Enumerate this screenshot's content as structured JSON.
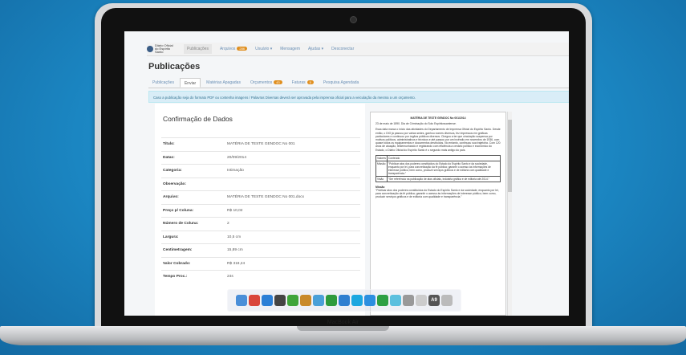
{
  "device": {
    "brand": "MacBook Air"
  },
  "app": {
    "logo_text": "Diário Oficial do Espírito Santo"
  },
  "nav": {
    "items": [
      {
        "label": "Publicações"
      },
      {
        "label": "Arquivos",
        "badge": "286"
      },
      {
        "label": "Usuário ▾"
      },
      {
        "label": "Mensagem"
      },
      {
        "label": "Ajudas ▾"
      },
      {
        "label": "Desconectar"
      }
    ]
  },
  "page": {
    "title": "Publicações"
  },
  "tabs": [
    {
      "label": "Publicações"
    },
    {
      "label": "Enviar"
    },
    {
      "label": "Matérias Apagadas"
    },
    {
      "label": "Orçamentos",
      "badge": "43"
    },
    {
      "label": "Faturas",
      "badge": "5"
    },
    {
      "label": "Pesquisa Agendada"
    }
  ],
  "alert": {
    "text": "Caso a publicação seja do formato PDF ou contenha imagens / Palavras Diversas deverá ser aprovada pela imprensa oficial para a veiculação da mesma a um orçamento."
  },
  "confirm": {
    "title": "Confirmação de Dados",
    "rows": [
      {
        "key": "Título:",
        "value": "MATÉRIA DE TESTE GENDOC No 001"
      },
      {
        "key": "Datas:",
        "value": "20/09/2014"
      },
      {
        "key": "Categoria:",
        "value": "Intimação"
      },
      {
        "key": "Observação:",
        "value": ""
      },
      {
        "key": "Arquivo:",
        "value": "MATÉRIA DE TESTE GENDOC No 001.docx"
      },
      {
        "key": "Preço p/ Coluna:",
        "value": "R$ 10,02"
      },
      {
        "key": "Número de Coluna:",
        "value": "2"
      },
      {
        "key": "Largura:",
        "value": "10,5 cm"
      },
      {
        "key": "Centimetragem:",
        "value": "15,89 cm"
      },
      {
        "key": "Valor Cobrado:",
        "value": "R$ 318,24"
      },
      {
        "key": "Tempo Proc.:",
        "value": "24s"
      }
    ]
  },
  "preview": {
    "title": "MATÉRIA DE TESTE GENDOC No 001/2014",
    "subtitle": "23 de maio de 1890. Dia de Criminação do Solo Espiritossantense.",
    "para1": "Essa data marca o início das atividades do Departamento de Imprensa Oficial do Espírito Santo. Desde então, o DIO já passou por várias sedes, ganhou nomes diversos, fez impressos em gráficas particulares e continuou por órgãos públicos diversos. Chegou a ter que circulação suspensa por motivos políticos, administrativos e técnicos e até passou por um incêndio em novembro de 1936, com quase todos os equipamentos e documentos destruídos. No entanto, continuou sua trajetória. Com 120 anos de atuação, testemunhando e registrando com eficiência a cenário político e econômico do Estado, o Diário Oficial do Espírito Santo é o segundo mais antigo do país.",
    "table": {
      "headers": [
        "Valores",
        "Conteúdo"
      ],
      "rows": [
        [
          "Missão",
          "\"Publicar atos dos poderes constituídos do Estado do Espírito Santo e da sociedade, enquanto por lei, para concretização da fé pública; garantir o acesso às informações de interesse público; bem como, produzir serviços gráficos e de editoria com qualidade e transparência.\""
        ],
        [
          "Visão",
          "\"Ser referência na publicação de atos oficiais, indústria gráfica e de editoria até 2014.\""
        ]
      ]
    },
    "section": "Missão",
    "para2": "\"Publicar atos dos poderes constituídos do Estado do Espírito Santo e da sociedade, enquanto por lei, para concretização da fé pública; garantir o acesso às informações de interesse público; bem como, produzir serviços gráficos e de editoria com qualidade e transparência.\""
  },
  "dock": {
    "icons": [
      {
        "name": "finder-icon",
        "color": "#4a8fd8"
      },
      {
        "name": "chrome-icon",
        "color": "#d9463b"
      },
      {
        "name": "itunes-icon",
        "color": "#2b7fd6"
      },
      {
        "name": "person-icon",
        "color": "#444444"
      },
      {
        "name": "evernote-icon",
        "color": "#3fa53a"
      },
      {
        "name": "books-icon",
        "color": "#c98a2a"
      },
      {
        "name": "photo-icon",
        "color": "#4aa0d8"
      },
      {
        "name": "facetime-icon",
        "color": "#2e9b3c"
      },
      {
        "name": "safari-icon",
        "color": "#2f7fd0"
      },
      {
        "name": "skype-icon",
        "color": "#1ca7e0"
      },
      {
        "name": "appstore-icon",
        "color": "#2c8fe0"
      },
      {
        "name": "spotify-icon",
        "color": "#2ea043"
      },
      {
        "name": "messages-icon",
        "color": "#5bc0de"
      },
      {
        "name": "network-icon",
        "color": "#999999"
      },
      {
        "name": "preview-icon",
        "color": "#cccccc"
      },
      {
        "name": "font-icon",
        "color": "#555555",
        "label": "A9"
      },
      {
        "name": "trash-icon",
        "color": "#bbbbbb"
      }
    ]
  }
}
